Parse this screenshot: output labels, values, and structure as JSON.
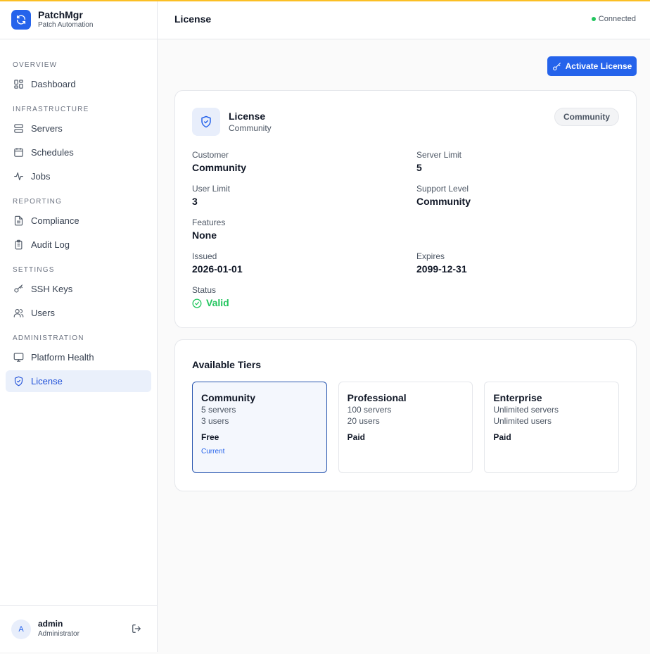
{
  "brand": {
    "name": "PatchMgr",
    "subtitle": "Patch Automation"
  },
  "sidebar": {
    "sections": [
      {
        "label": "OVERVIEW",
        "items": [
          {
            "label": "Dashboard",
            "icon": "dashboard-icon"
          }
        ]
      },
      {
        "label": "INFRASTRUCTURE",
        "items": [
          {
            "label": "Servers",
            "icon": "server-icon"
          },
          {
            "label": "Schedules",
            "icon": "calendar-icon"
          },
          {
            "label": "Jobs",
            "icon": "activity-icon"
          }
        ]
      },
      {
        "label": "REPORTING",
        "items": [
          {
            "label": "Compliance",
            "icon": "document-icon"
          },
          {
            "label": "Audit Log",
            "icon": "clipboard-icon"
          }
        ]
      },
      {
        "label": "SETTINGS",
        "items": [
          {
            "label": "SSH Keys",
            "icon": "key-icon"
          },
          {
            "label": "Users",
            "icon": "users-icon"
          }
        ]
      },
      {
        "label": "ADMINISTRATION",
        "items": [
          {
            "label": "Platform Health",
            "icon": "monitor-icon"
          },
          {
            "label": "License",
            "icon": "shield-icon",
            "active": true
          }
        ]
      }
    ]
  },
  "user": {
    "initial": "A",
    "name": "admin",
    "role": "Administrator"
  },
  "header": {
    "title": "License",
    "status": "Connected",
    "status_color": "#22c55e"
  },
  "actions": {
    "activate_label": "Activate License"
  },
  "license": {
    "title": "License",
    "subtitle": "Community",
    "badge": "Community",
    "fields": {
      "customer": {
        "label": "Customer",
        "value": "Community"
      },
      "server_limit": {
        "label": "Server Limit",
        "value": "5"
      },
      "user_limit": {
        "label": "User Limit",
        "value": "3"
      },
      "support_level": {
        "label": "Support Level",
        "value": "Community"
      },
      "features": {
        "label": "Features",
        "value": "None"
      },
      "issued": {
        "label": "Issued",
        "value": "2026-01-01"
      },
      "expires": {
        "label": "Expires",
        "value": "2099-12-31"
      },
      "status": {
        "label": "Status",
        "value": "Valid"
      }
    }
  },
  "tiers": {
    "title": "Available Tiers",
    "items": [
      {
        "name": "Community",
        "servers": "5 servers",
        "users": "3 users",
        "price": "Free",
        "current_label": "Current"
      },
      {
        "name": "Professional",
        "servers": "100 servers",
        "users": "20 users",
        "price": "Paid"
      },
      {
        "name": "Enterprise",
        "servers": "Unlimited servers",
        "users": "Unlimited users",
        "price": "Paid"
      }
    ]
  },
  "colors": {
    "accent": "#2563eb",
    "top_bar": "#fbbf24",
    "valid": "#22c55e"
  }
}
